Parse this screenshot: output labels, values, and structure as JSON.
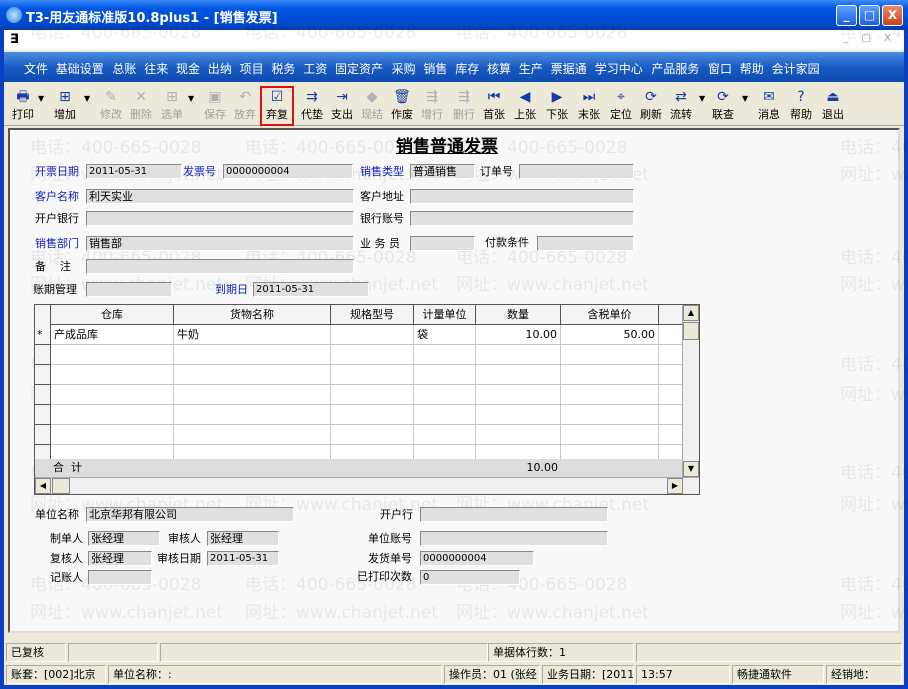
{
  "window": {
    "title": "T3-用友通标准版10.8plus1 - [销售发票]",
    "min": "_",
    "max": "□",
    "close": "X"
  },
  "mdi": {
    "sys_icon": "∃",
    "controls": "_ □ X"
  },
  "menu": [
    "文件",
    "基础设置",
    "总账",
    "往来",
    "现金",
    "出纳",
    "项目",
    "税务",
    "工资",
    "固定资产",
    "采购",
    "销售",
    "库存",
    "核算",
    "生产",
    "票据通",
    "学习中心",
    "产品服务",
    "窗口",
    "帮助",
    "会计家园"
  ],
  "toolbar": [
    {
      "label": "打印",
      "icon": "🖶",
      "enabled": true
    },
    {
      "label": "增加",
      "icon": "⊞",
      "enabled": true
    },
    {
      "label": "修改",
      "icon": "✎",
      "enabled": false
    },
    {
      "label": "删除",
      "icon": "✕",
      "enabled": false
    },
    {
      "label": "选单",
      "icon": "⊞",
      "enabled": false
    },
    {
      "label": "保存",
      "icon": "▣",
      "enabled": false
    },
    {
      "label": "放弃",
      "icon": "↶",
      "enabled": false
    },
    {
      "label": "弃复",
      "icon": "☑",
      "enabled": true,
      "highlighted": true
    },
    {
      "label": "代垫",
      "icon": "⇉",
      "enabled": true
    },
    {
      "label": "支出",
      "icon": "⇥",
      "enabled": true
    },
    {
      "label": "现结",
      "icon": "◆",
      "enabled": false
    },
    {
      "label": "作废",
      "icon": "🗑",
      "enabled": true
    },
    {
      "label": "增行",
      "icon": "⇶",
      "enabled": false
    },
    {
      "label": "删行",
      "icon": "⇶",
      "enabled": false
    },
    {
      "label": "首张",
      "icon": "⏮",
      "enabled": true
    },
    {
      "label": "上张",
      "icon": "◀",
      "enabled": true
    },
    {
      "label": "下张",
      "icon": "▶",
      "enabled": true
    },
    {
      "label": "末张",
      "icon": "⏭",
      "enabled": true
    },
    {
      "label": "定位",
      "icon": "⌖",
      "enabled": true
    },
    {
      "label": "刷新",
      "icon": "⟳",
      "enabled": true
    },
    {
      "label": "流转",
      "icon": "⇄",
      "enabled": true
    },
    {
      "label": "联查",
      "icon": "⟳",
      "enabled": true
    },
    {
      "label": "消息",
      "icon": "✉",
      "enabled": true
    },
    {
      "label": "帮助",
      "icon": "?",
      "enabled": true
    },
    {
      "label": "退出",
      "icon": "⏏",
      "enabled": true
    }
  ],
  "doc": {
    "title": "销售普通发票",
    "header": {
      "invoice_date_label": "开票日期",
      "invoice_date": "2011-05-31",
      "invoice_no_label": "发票号",
      "invoice_no": "0000000004",
      "sale_type_label": "销售类型",
      "sale_type": "普通销售",
      "order_no_label": "订单号",
      "order_no": "",
      "customer_label": "客户名称",
      "customer": "利天实业",
      "address_label": "客户地址",
      "address": "",
      "bank_label": "开户银行",
      "bank": "",
      "account_label": "银行账号",
      "account": "",
      "dept_label": "销售部门",
      "dept": "销售部",
      "salesman_label": "业 务 员",
      "salesman": "",
      "terms_label": "付款条件",
      "terms": "",
      "remark_label": "备    注",
      "remark": "",
      "period_label": "账期管理",
      "period": "",
      "due_label": "到期日",
      "due": "2011-05-31"
    },
    "grid": {
      "columns": [
        "仓库",
        "货物名称",
        "规格型号",
        "计量单位",
        "数量",
        "含税单价"
      ],
      "rows": [
        {
          "marker": "*",
          "warehouse": "产成品库",
          "goods": "牛奶",
          "spec": "",
          "unit": "袋",
          "qty": "10.00",
          "price": "50.00"
        }
      ],
      "total_label": "合  计",
      "total_qty": "10.00"
    },
    "footer": {
      "company_label": "单位名称",
      "company": "北京华邦有限公司",
      "open_bank_label": "开户行",
      "open_bank": "",
      "maker_label": "制单人",
      "maker": "张经理",
      "auditor_label": "审核人",
      "auditor": "张经理",
      "unit_account_label": "单位账号",
      "unit_account": "",
      "reviewer_label": "复核人",
      "reviewer": "张经理",
      "audit_date_label": "审核日期",
      "audit_date": "2011-05-31",
      "ship_no_label": "发货单号",
      "ship_no": "0000000004",
      "bookkeeper_label": "记账人",
      "bookkeeper": "",
      "print_count_label": "已打印次数",
      "print_count": "0"
    }
  },
  "status": {
    "state": "已复核",
    "rows_count": "单据体行数：1"
  },
  "bottom": {
    "account_set": "账套：[002]北京",
    "unit_name": "单位名称：:",
    "operator": "操作员：01 (张经",
    "biz_date": "业务日期：[2011",
    "time": "13:57",
    "vendor": "畅捷通软件",
    "dealer": "经销地："
  },
  "watermark": {
    "phone": "电话：400-665-0028",
    "site": "网址：www.chanjet.net"
  }
}
